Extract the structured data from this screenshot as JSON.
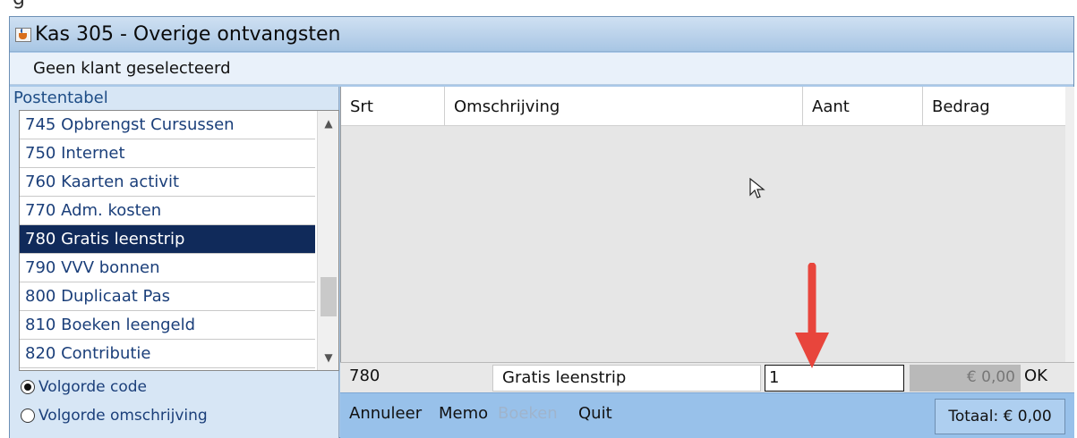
{
  "caption": "g",
  "window": {
    "title": "Kas 305 - Overige ontvangsten"
  },
  "customer_bar": {
    "text": "Geen klant geselecteerd"
  },
  "left_pane": {
    "label": "Postentabel",
    "items": [
      {
        "code": "745",
        "name": "Opbrengst Cursussen"
      },
      {
        "code": "750",
        "name": "Internet"
      },
      {
        "code": "760",
        "name": "Kaarten activit"
      },
      {
        "code": "770",
        "name": "Adm. kosten"
      },
      {
        "code": "780",
        "name": "Gratis leenstrip",
        "selected": true
      },
      {
        "code": "790",
        "name": "VVV bonnen"
      },
      {
        "code": "800",
        "name": "Duplicaat Pas"
      },
      {
        "code": "810",
        "name": "Boeken leengeld"
      },
      {
        "code": "820",
        "name": "Contributie"
      }
    ],
    "sort_options": [
      {
        "label": "Volgorde code",
        "checked": true
      },
      {
        "label": "Volgorde omschrijving",
        "checked": false
      }
    ]
  },
  "table": {
    "headers": [
      "Srt",
      "Omschrijving",
      "Aant",
      "Bedrag"
    ],
    "rows": []
  },
  "entry": {
    "code": "780",
    "description": "Gratis leenstrip",
    "quantity": "1",
    "amount": "€ 0,00",
    "ok_label": "OK"
  },
  "buttons": {
    "cancel": "Annuleer",
    "memo": "Memo",
    "book": "Boeken",
    "quit": "Quit"
  },
  "total": "Totaal: € 0,00",
  "colors": {
    "selection": "#102a5a",
    "arrow": "#e8453c",
    "button_bar": "#98c1ea"
  }
}
